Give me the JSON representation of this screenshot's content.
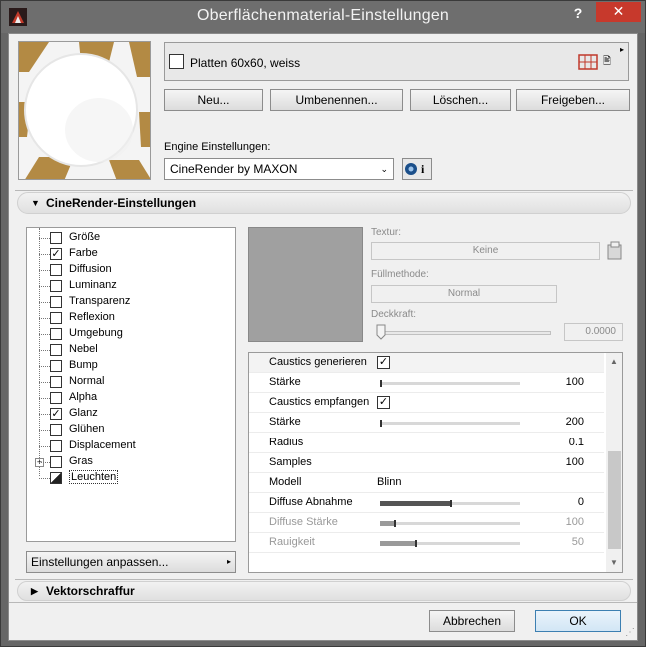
{
  "window": {
    "title": "Oberflächenmaterial-Einstellungen",
    "help": "?",
    "close": "✕"
  },
  "surface": {
    "name": "Platten 60x60, weiss",
    "doc_icon": "🖹",
    "menu_arrow": "▸"
  },
  "buttons": {
    "neu": "Neu...",
    "umbenennen": "Umbenennen...",
    "loeschen": "Löschen...",
    "freigeben": "Freigeben..."
  },
  "engine": {
    "label": "Engine Einstellungen:",
    "selected": "CineRender by MAXON",
    "arrow": "⌄",
    "info_icon": "i"
  },
  "sections": {
    "cinerender": "CineRender-Einstellungen",
    "cinerender_tri": "▼",
    "vektor": "Vektorschraffur",
    "vektor_tri": "▶"
  },
  "channels": [
    {
      "label": "Größe",
      "check": ""
    },
    {
      "label": "Farbe",
      "check": "✓"
    },
    {
      "label": "Diffusion",
      "check": ""
    },
    {
      "label": "Luminanz",
      "check": ""
    },
    {
      "label": "Transparenz",
      "check": ""
    },
    {
      "label": "Reflexion",
      "check": ""
    },
    {
      "label": "Umgebung",
      "check": ""
    },
    {
      "label": "Nebel",
      "check": ""
    },
    {
      "label": "Bump",
      "check": ""
    },
    {
      "label": "Normal",
      "check": ""
    },
    {
      "label": "Alpha",
      "check": ""
    },
    {
      "label": "Glanz",
      "check": "✓"
    },
    {
      "label": "Glühen",
      "check": ""
    },
    {
      "label": "Displacement",
      "check": ""
    },
    {
      "label": "Gras",
      "check": ""
    },
    {
      "label": "Leuchten",
      "check": ""
    }
  ],
  "settings_button": {
    "label": "Einstellungen anpassen...",
    "arrow": "▸"
  },
  "texture": {
    "textur_label": "Textur:",
    "textur_value": "Keine",
    "fill_label": "Füllmethode:",
    "fill_value": "Normal",
    "opacity_label": "Deckkraft:",
    "opacity_value": "0.0000"
  },
  "properties": [
    {
      "name": "Caustics generieren",
      "value": "",
      "check": "✓",
      "slider": null,
      "disabled": false
    },
    {
      "name": "Stärke",
      "value": "100",
      "check": null,
      "slider": 0.0,
      "disabled": false
    },
    {
      "name": "Caustics empfangen",
      "value": "",
      "check": "✓",
      "slider": null,
      "disabled": false
    },
    {
      "name": "Stärke",
      "value": "200",
      "check": null,
      "slider": 0.0,
      "disabled": false
    },
    {
      "name": "Radius",
      "value": "0.1",
      "check": null,
      "slider": null,
      "disabled": false
    },
    {
      "name": "Samples",
      "value": "100",
      "check": null,
      "slider": null,
      "disabled": false
    },
    {
      "name": "Modell",
      "value": "Blinn",
      "check": null,
      "slider": null,
      "disabled": false
    },
    {
      "name": "Diffuse Abnahme",
      "value": "0",
      "check": null,
      "slider": 0.5,
      "disabled": false
    },
    {
      "name": "Diffuse Stärke",
      "value": "100",
      "check": null,
      "slider": 0.1,
      "disabled": true
    },
    {
      "name": "Rauigkeit",
      "value": "50",
      "check": null,
      "slider": 0.25,
      "disabled": true
    }
  ],
  "footer": {
    "cancel": "Abbrechen",
    "ok": "OK"
  }
}
